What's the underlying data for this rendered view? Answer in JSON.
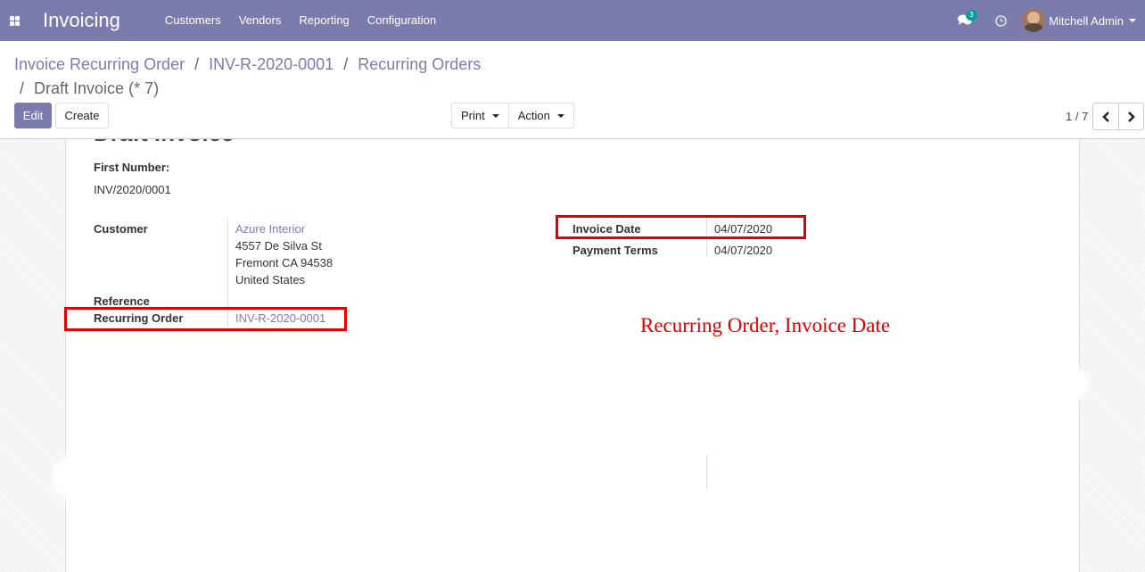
{
  "navbar": {
    "app_title": "Invoicing",
    "menu": [
      "Customers",
      "Vendors",
      "Reporting",
      "Configuration"
    ],
    "chat_count": "3",
    "user_name": "Mitchell Admin",
    "color": "#7c7bad"
  },
  "breadcrumb": {
    "items": [
      "Invoice Recurring Order",
      "INV-R-2020-0001",
      "Recurring Orders"
    ],
    "active": "Draft Invoice (* 7)",
    "separator": "/"
  },
  "toolbar": {
    "edit_label": "Edit",
    "create_label": "Create",
    "print_label": "Print",
    "action_label": "Action"
  },
  "pager": {
    "value": "1 / 7",
    "prev_icon": "chevron-left-icon",
    "next_icon": "chevron-right-icon"
  },
  "form": {
    "title": "Draft Invoice",
    "first_number_label": "First Number:",
    "first_number_value": "INV/2020/0001",
    "customer_label": "Customer",
    "customer_name": "Azure Interior",
    "customer_address": [
      "4557 De Silva St",
      "Fremont CA 94538",
      "United States"
    ],
    "reference_label": "Reference",
    "recurring_order_label": "Recurring Order",
    "recurring_order_value": "INV-R-2020-0001",
    "invoice_date_label": "Invoice Date",
    "invoice_date_value": "04/07/2020",
    "payment_terms_label": "Payment Terms",
    "payment_terms_value": "04/07/2020"
  },
  "annotation": {
    "text": "Recurring Order, Invoice Date",
    "color": "#e00000"
  }
}
